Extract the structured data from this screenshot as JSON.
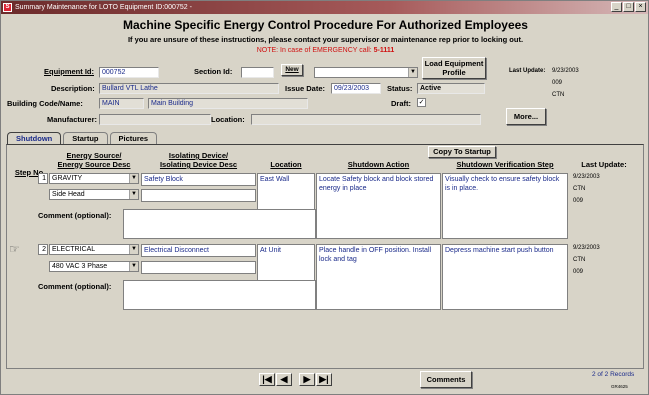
{
  "window": {
    "title": "Summary Maintenance for LOTO Equipment ID:000752 -",
    "min": "_",
    "max": "□",
    "close": "×"
  },
  "header": {
    "title": "Machine Specific Energy Control Procedure For Authorized Employees",
    "subtitle": "If you are unsure of these instructions, please contact your supervisor or maintenance rep prior to locking out.",
    "note_prefix": "NOTE: In case of EMERGENCY call:",
    "note_phone": "5-1111"
  },
  "form": {
    "equipment_id_label": "Equipment Id:",
    "equipment_id": "000752",
    "section_id_label": "Section Id:",
    "section_id": "",
    "new_label": "New",
    "section_combo": "",
    "load_profile_label": "Load Equipment Profile",
    "last_update_label": "Last Update:",
    "last_update_date": "9/23/2003",
    "last_update_code": "009",
    "last_update_user": "CTN",
    "description_label": "Description:",
    "description": "Bullard VTL Lathe",
    "issue_date_label": "Issue Date:",
    "issue_date": "09/23/2003",
    "status_label": "Status:",
    "status": "Active",
    "building_label": "Building Code/Name:",
    "building_code": "MAIN",
    "building_name": "Main Building",
    "draft_label": "Draft:",
    "draft_checked": "✓",
    "manufacturer_label": "Manufacturer:",
    "manufacturer": "",
    "location_label": "Location:",
    "location": "",
    "more_label": "More..."
  },
  "tabs": [
    "Shutdown",
    "Startup",
    "Pictures"
  ],
  "grid": {
    "copy_to_startup": "Copy To Startup",
    "headers": {
      "step_no": "Step No",
      "energy_line1": "Energy Source/",
      "energy_line2": "Energy Source Desc",
      "isolating_line1": "Isolating Device/",
      "isolating_line2": "Isolating Device Desc",
      "location": "Location",
      "shutdown_action": "Shutdown Action",
      "verification": "Shutdown Verification Step",
      "last_update": "Last Update:"
    },
    "comment_label": "Comment (optional):",
    "rows": [
      {
        "step": "1",
        "energy_source": "GRAVITY",
        "energy_desc": "Side Head",
        "isolating_device": "Safety Block",
        "isolating_desc": "",
        "location": "East Wall",
        "action": "Locate Safety block and block stored energy in place",
        "verification": "Visually check to ensure safety block is in place.",
        "update_date": "9/23/2003",
        "update_user": "CTN",
        "update_code": "009",
        "comment": ""
      },
      {
        "step": "2",
        "energy_source": "ELECTRICAL",
        "energy_desc": "480 VAC 3 Phase",
        "isolating_device": "Electrical Disconnect",
        "isolating_desc": "",
        "location": "At Unit",
        "action": "Place handle in OFF position. Install lock and tag",
        "verification": "Depress machine start push button",
        "update_date": "9/23/2003",
        "update_user": "CTN",
        "update_code": "009",
        "comment": ""
      }
    ]
  },
  "footer": {
    "nav_first": "|◀",
    "nav_prev": "◀",
    "nav_next": "▶",
    "nav_last": "▶|",
    "comments_label": "Comments",
    "record_count": "2 of 2 Records",
    "small_code": "GR4625"
  }
}
